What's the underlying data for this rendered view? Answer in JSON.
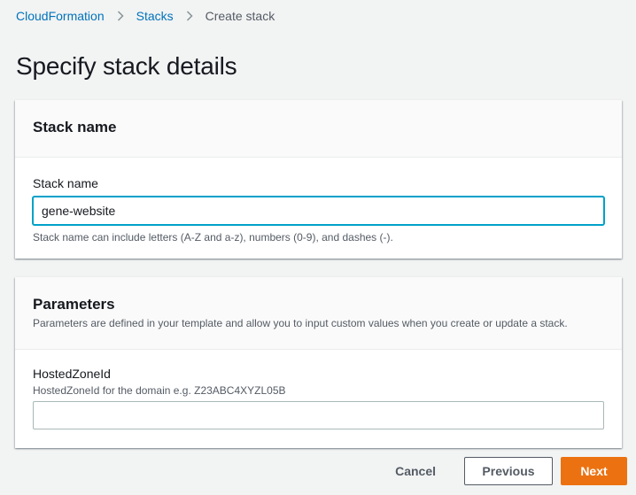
{
  "breadcrumb": {
    "items": [
      {
        "label": "CloudFormation"
      },
      {
        "label": "Stacks"
      }
    ],
    "current": "Create stack",
    "separator_icon": "chevron-right-icon"
  },
  "page": {
    "title": "Specify stack details"
  },
  "stack_name_panel": {
    "title": "Stack name",
    "field_label": "Stack name",
    "value": "gene-website",
    "constraint": "Stack name can include letters (A-Z and a-z), numbers (0-9), and dashes (-)."
  },
  "parameters_panel": {
    "title": "Parameters",
    "description": "Parameters are defined in your template and allow you to input custom values when you create or update a stack.",
    "fields": [
      {
        "label": "HostedZoneId",
        "description": "HostedZoneId for the domain e.g. Z23ABC4XYZL05B",
        "value": ""
      }
    ]
  },
  "actions": {
    "cancel": "Cancel",
    "previous": "Previous",
    "next": "Next"
  },
  "colors": {
    "link": "#0073bb",
    "primary": "#ec7211",
    "focus": "#00a1c9",
    "background": "#f2f3f3"
  }
}
